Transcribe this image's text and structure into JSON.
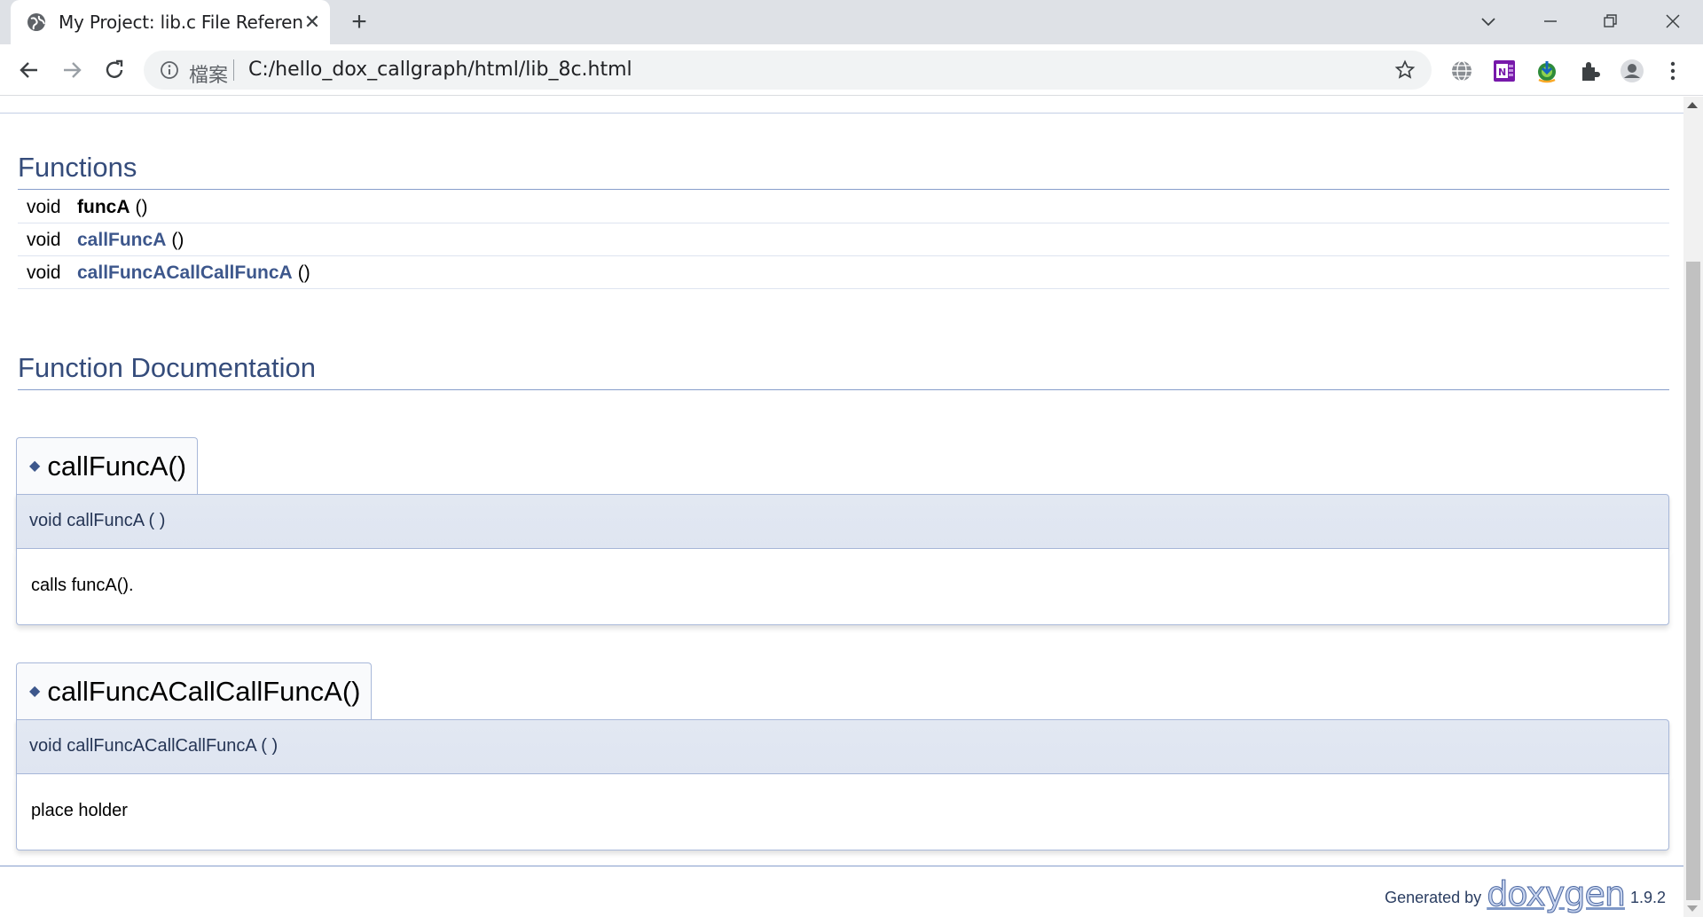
{
  "browser": {
    "tab_title": "My Project: lib.c File Reference",
    "omnibox_label": "檔案",
    "url": "C:/hello_dox_callgraph/html/lib_8c.html"
  },
  "page": {
    "functions_header": "Functions",
    "members": [
      {
        "type": "void",
        "name": "funcA",
        "args": "()"
      },
      {
        "type": "void",
        "name": "callFuncA",
        "args": "()"
      },
      {
        "type": "void",
        "name": "callFuncACallCallFuncA",
        "args": "()"
      }
    ],
    "doc_header": "Function Documentation",
    "docs": [
      {
        "title": "callFuncA()",
        "proto": "void callFuncA (  )",
        "text": "calls funcA()."
      },
      {
        "title": "callFuncACallCallFuncA()",
        "proto": "void callFuncACallCallFuncA (  )",
        "text": "place holder"
      }
    ],
    "footer": {
      "generated_by": "Generated by",
      "logo": "doxygen",
      "version": "1.9.2"
    }
  },
  "colors": {
    "header_blue": "#354c7b",
    "link_blue": "#3d578c",
    "proto_bg": "#e2e8f2"
  }
}
